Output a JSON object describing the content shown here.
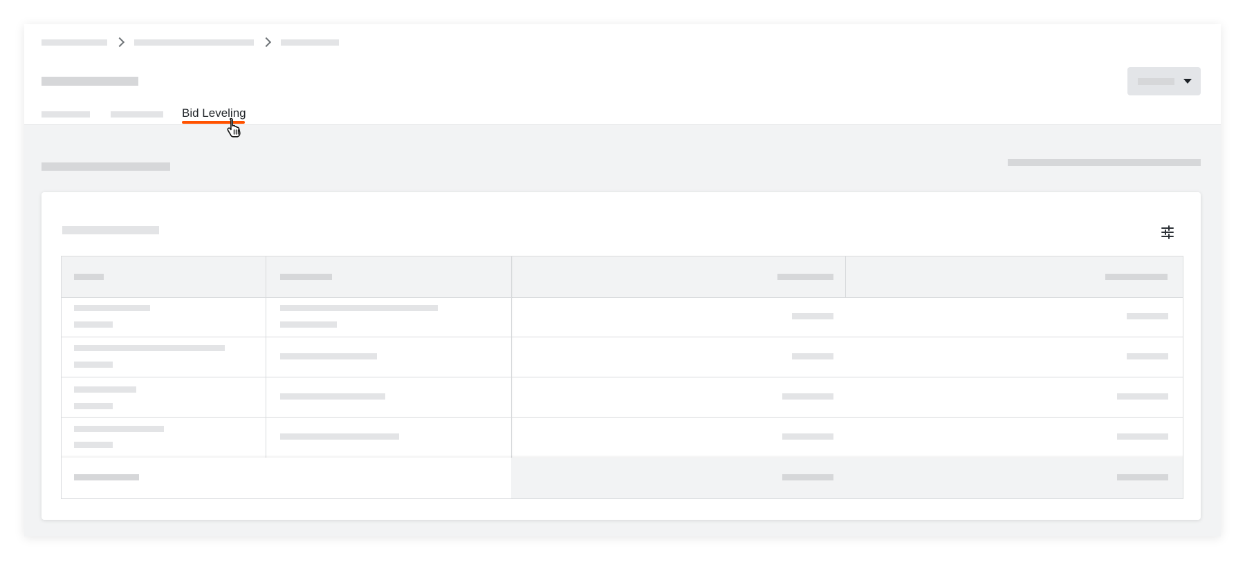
{
  "tabs": {
    "active_label": "Bid Leveling"
  },
  "icons": {
    "breadcrumb_separator": "chevron-right-icon",
    "dropdown": "caret-down-icon",
    "table_settings": "sliders-icon",
    "cursor": "hand-pointer-icon"
  },
  "colors": {
    "accent": "#ff5200",
    "placeholder": "#e3e4e6",
    "page_background": "#f2f3f4"
  }
}
